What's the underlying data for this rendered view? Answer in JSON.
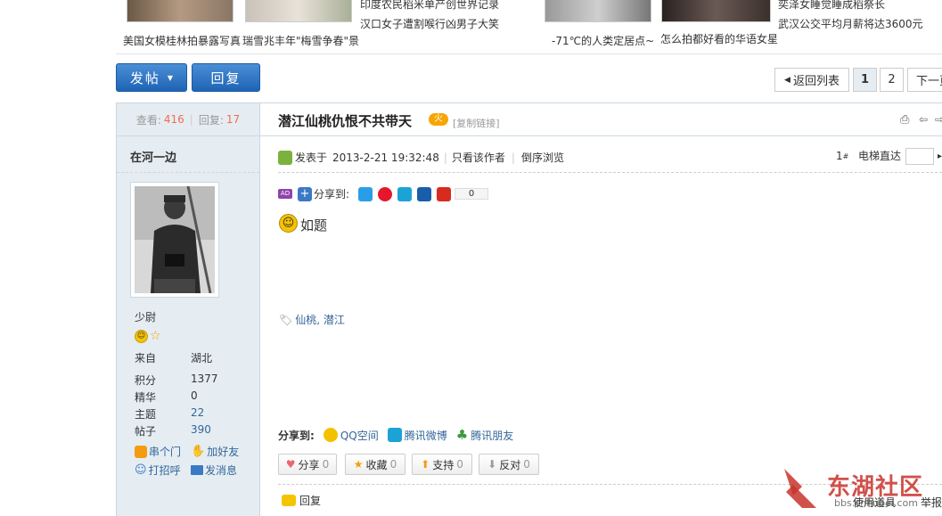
{
  "strip": {
    "cap1": "印度农民稻米单产创世界记录",
    "cap2": "汉口女子遭割喉行凶男子大笑",
    "cap3": "美国女模桂林拍暴露写真",
    "cap4": "瑞雪兆丰年\"梅雪争春\"景",
    "cap5": "奕泽女睡觉睡成稻祭长",
    "cap6": "武汉公交平均月薪将达3600元",
    "cap7": "-71℃的人类定居点~",
    "cap8": "怎么拍都好看的华语女星"
  },
  "toolbar": {
    "post_label": "发帖",
    "reply_label": "回复",
    "back_label": "返回列表",
    "page1": "1",
    "page2": "2",
    "next_label": "下一页"
  },
  "stats": {
    "views_label": "查看:",
    "views": "416",
    "sep": "|",
    "replies_label": "回复:",
    "replies": "17"
  },
  "thread": {
    "title": "潜江仙桃仇恨不共带天",
    "copy_link": "[复制链接]"
  },
  "author": {
    "name": "在河一边",
    "rank": "少尉",
    "from_label": "来自",
    "from": "湖北",
    "points_label": "积分",
    "points": "1377",
    "essence_label": "精华",
    "essence": "0",
    "topics_label": "主题",
    "topics": "22",
    "posts_label": "帖子",
    "posts": "390",
    "visit": "串个门",
    "add_friend": "加好友",
    "greet": "打招呼",
    "message": "发消息"
  },
  "post": {
    "posted_on": "发表于",
    "datetime": "2013-2-21 19:32:48",
    "only_author": "只看该作者",
    "reverse": "倒序浏览",
    "floor": "1",
    "floor_sup": "#",
    "jump_label": "电梯直达",
    "share_to": "分享到:",
    "share_count": "0",
    "content": "如题",
    "tags": "仙桃, 潜江",
    "share2_label": "分享到:",
    "qzone": "QQ空间",
    "tweibo": "腾讯微博",
    "tfriends": "腾讯朋友"
  },
  "actions": {
    "share": "分享",
    "share_n": "0",
    "fav": "收藏",
    "fav_n": "0",
    "support": "支持",
    "support_n": "0",
    "oppose": "反对",
    "oppose_n": "0",
    "reply": "回复",
    "tools": "使用道具",
    "report": "举报"
  },
  "watermark": {
    "brand": "东湖社区",
    "url": "bbs.cnhubei.com"
  }
}
